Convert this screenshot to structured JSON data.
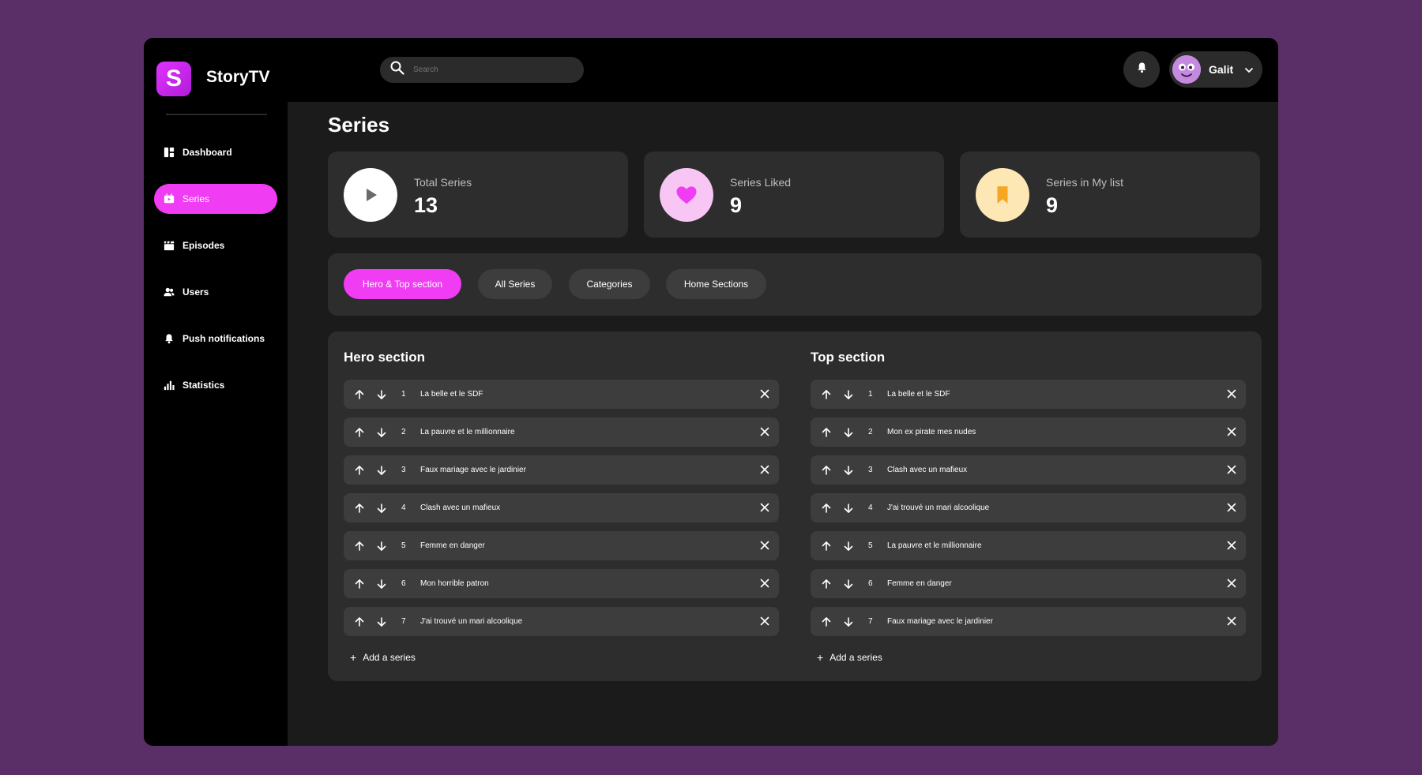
{
  "app": {
    "brand": "StoryTV",
    "logo_letter": "S"
  },
  "search": {
    "placeholder": "Search"
  },
  "user": {
    "name": "Galit"
  },
  "sidebar": {
    "items": [
      {
        "label": "Dashboard",
        "icon": "dashboard-icon"
      },
      {
        "label": "Series",
        "icon": "series-icon",
        "active": true
      },
      {
        "label": "Episodes",
        "icon": "clapperboard-icon"
      },
      {
        "label": "Users",
        "icon": "users-icon"
      },
      {
        "label": "Push notifications",
        "icon": "bell-icon"
      },
      {
        "label": "Statistics",
        "icon": "bar-chart-icon"
      }
    ]
  },
  "page": {
    "title": "Series"
  },
  "stats": [
    {
      "label": "Total Series",
      "value": "13",
      "icon": "play-icon",
      "color": "#ffffff"
    },
    {
      "label": "Series Liked",
      "value": "9",
      "icon": "heart-icon",
      "color": "#f7c6f4"
    },
    {
      "label": "Series in My list",
      "value": "9",
      "icon": "bookmark-icon",
      "color": "#fde7b4"
    }
  ],
  "tabs": [
    {
      "label": "Hero & Top section",
      "active": true
    },
    {
      "label": "All Series"
    },
    {
      "label": "Categories"
    },
    {
      "label": "Home Sections"
    }
  ],
  "hero": {
    "title": "Hero section",
    "rows": [
      {
        "num": "1",
        "title": "La belle et le SDF"
      },
      {
        "num": "2",
        "title": "La pauvre et le millionnaire"
      },
      {
        "num": "3",
        "title": "Faux mariage avec le jardinier"
      },
      {
        "num": "4",
        "title": "Clash avec un mafieux"
      },
      {
        "num": "5",
        "title": "Femme en danger"
      },
      {
        "num": "6",
        "title": "Mon horrible patron"
      },
      {
        "num": "7",
        "title": "J'ai trouvé un mari alcoolique"
      }
    ],
    "add_label": "Add a series"
  },
  "top": {
    "title": "Top section",
    "rows": [
      {
        "num": "1",
        "title": "La belle et le SDF"
      },
      {
        "num": "2",
        "title": "Mon ex pirate mes nudes"
      },
      {
        "num": "3",
        "title": "Clash avec un mafieux"
      },
      {
        "num": "4",
        "title": "J'ai trouvé un mari alcoolique"
      },
      {
        "num": "5",
        "title": "La pauvre et le millionnaire"
      },
      {
        "num": "6",
        "title": "Femme en danger"
      },
      {
        "num": "7",
        "title": "Faux mariage avec le jardinier"
      }
    ],
    "add_label": "Add a series"
  },
  "colors": {
    "accent": "#f03cf2",
    "background": "#5a2f68",
    "panel": "#2d2d2d",
    "row": "#3d3d3d"
  }
}
